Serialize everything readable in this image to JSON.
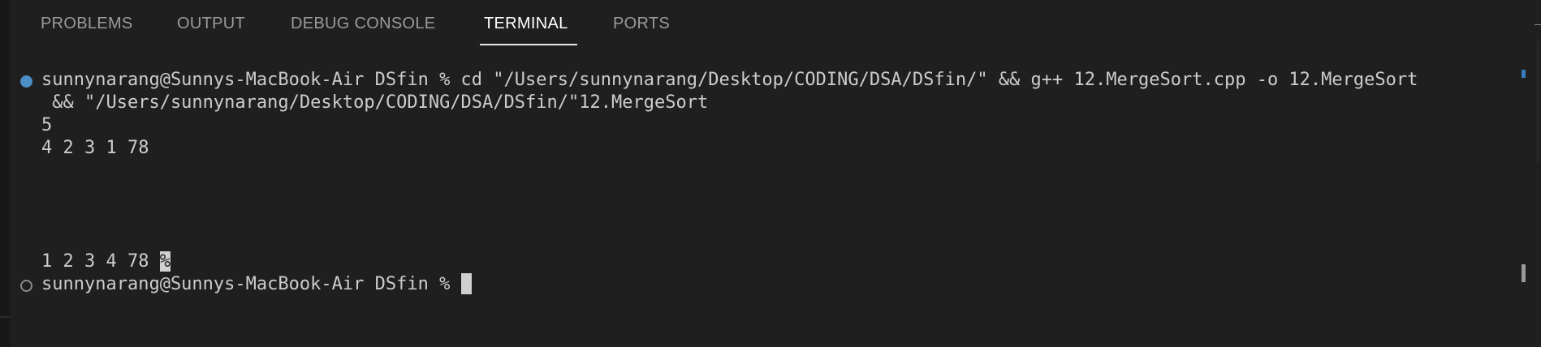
{
  "panel": {
    "tabs": [
      {
        "label": "PROBLEMS",
        "active": false
      },
      {
        "label": "OUTPUT",
        "active": false
      },
      {
        "label": "DEBUG CONSOLE",
        "active": false
      },
      {
        "label": "TERMINAL",
        "active": true
      },
      {
        "label": "PORTS",
        "active": false
      }
    ]
  },
  "terminal": {
    "command_line_1": "sunnynarang@Sunnys-MacBook-Air DSfin % cd \"/Users/sunnynarang/Desktop/CODING/DSA/DSfin/\" && g++ 12.MergeSort.cpp -o 12.MergeSort",
    "command_line_2": " && \"/Users/sunnynarang/Desktop/CODING/DSA/DSfin/\"12.MergeSort",
    "input_count": "5",
    "input_values": "4 2 3 1 78",
    "output_values": "1 2 3 4 78 ",
    "no_newline_marker": "%",
    "prompt": "sunnynarang@Sunnys-MacBook-Air DSfin % "
  },
  "colors": {
    "background": "#1f1f1f",
    "active_tab": "#ffffff",
    "inactive_tab": "#9a9a9a",
    "success_dot": "#4c8fc6",
    "text": "#cccccc"
  },
  "icons": {
    "command_status_done": "circle-filled-icon",
    "command_status_idle": "circle-outline-icon"
  }
}
